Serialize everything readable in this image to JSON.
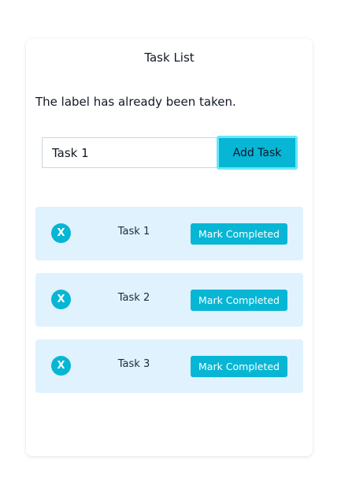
{
  "app": {
    "title": "Task List",
    "error_message": "The label has already been taken."
  },
  "form": {
    "input_value": "Task 1",
    "add_button_label": "Add Task"
  },
  "tasks": [
    {
      "label": "Task 1",
      "delete_label": "X",
      "complete_label": "Mark Completed"
    },
    {
      "label": "Task 2",
      "delete_label": "X",
      "complete_label": "Mark Completed"
    },
    {
      "label": "Task 3",
      "delete_label": "X",
      "complete_label": "Mark Completed"
    }
  ],
  "colors": {
    "accent": "#06b6d4",
    "task_background": "#e0f2fe",
    "focus_ring": "#67e8f9"
  }
}
